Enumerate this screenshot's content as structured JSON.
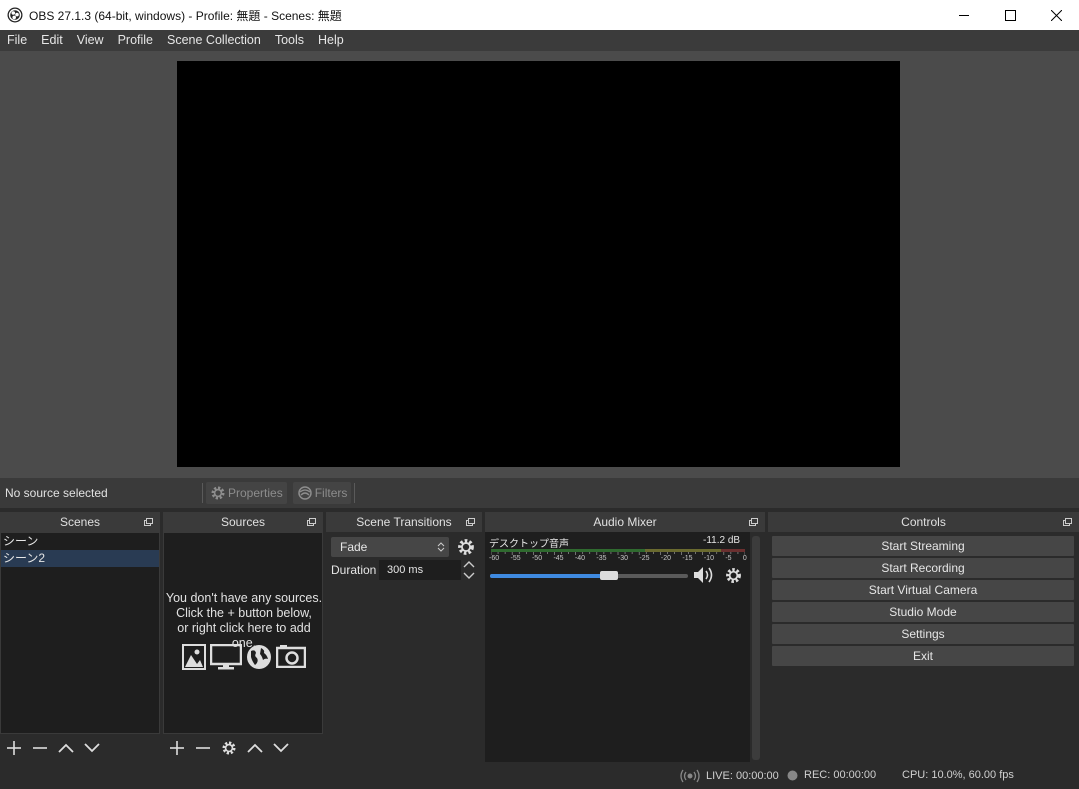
{
  "window": {
    "title": "OBS 27.1.3 (64-bit, windows) - Profile: 無題 - Scenes: 無題",
    "controls": [
      "minimize-icon",
      "maximize-icon",
      "close-icon"
    ]
  },
  "menu": {
    "items": [
      "File",
      "Edit",
      "View",
      "Profile",
      "Scene Collection",
      "Tools",
      "Help"
    ]
  },
  "source_toolbar": {
    "status": "No source selected",
    "properties_label": "Properties",
    "filters_label": "Filters"
  },
  "scenes": {
    "title": "Scenes",
    "items": [
      "シーン",
      "シーン2"
    ],
    "selected_index": 1
  },
  "sources": {
    "title": "Sources",
    "empty_line1": "You don't have any sources.",
    "empty_line2": "Click the + button below,",
    "empty_line3": "or right click here to add one.",
    "empty_icons": [
      "image-icon",
      "display-icon",
      "globe-icon",
      "camera-icon"
    ]
  },
  "transitions": {
    "title": "Scene Transitions",
    "selected": "Fade",
    "duration_label": "Duration",
    "duration_value": "300 ms"
  },
  "mixer": {
    "title": "Audio Mixer",
    "channel_name": "デスクトップ音声",
    "level": "-11.2 dB",
    "scale": [
      "-60",
      "-55",
      "-50",
      "-45",
      "-40",
      "-35",
      "-30",
      "-25",
      "-20",
      "-15",
      "-10",
      "-5",
      "0"
    ],
    "volume_fraction": 0.6
  },
  "controls": {
    "title": "Controls",
    "buttons": [
      "Start Streaming",
      "Start Recording",
      "Start Virtual Camera",
      "Studio Mode",
      "Settings",
      "Exit"
    ]
  },
  "status": {
    "live": "LIVE: 00:00:00",
    "rec": "REC: 00:00:00",
    "cpu": "CPU: 10.0%, 60.00 fps"
  },
  "colors": {
    "accent": "#3f8ae0",
    "selection": "#293b53",
    "panel": "#2b2b2b",
    "preview_bg": "#000000"
  }
}
